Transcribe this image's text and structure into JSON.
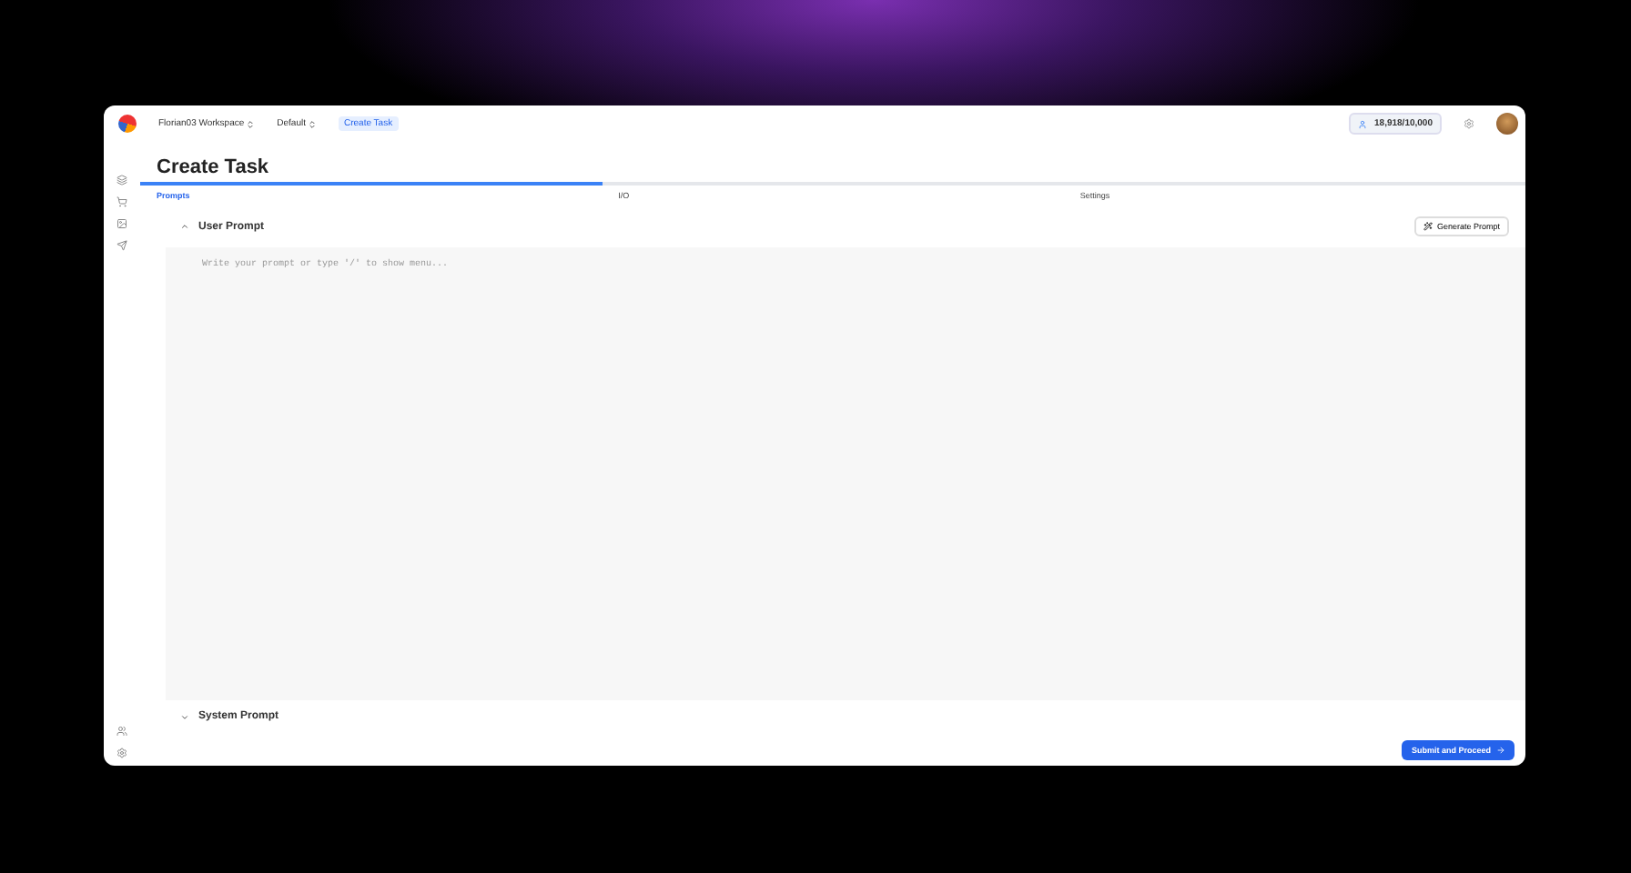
{
  "topbar": {
    "workspace": "Florian03 Workspace",
    "project": "Default",
    "page": "Create Task",
    "credits": "18,918/10,000"
  },
  "title": "Create Task",
  "tabs": [
    {
      "label": "Prompts",
      "selected": true
    },
    {
      "label": "I/O",
      "selected": false
    },
    {
      "label": "Settings",
      "selected": false
    }
  ],
  "sections": [
    {
      "title": "User Prompt",
      "expanded": true,
      "placeholder": "Write your prompt or type '/' to show menu...",
      "action": "Generate Prompt"
    },
    {
      "title": "System Prompt",
      "expanded": false
    }
  ],
  "submit": "Submit and Proceed"
}
